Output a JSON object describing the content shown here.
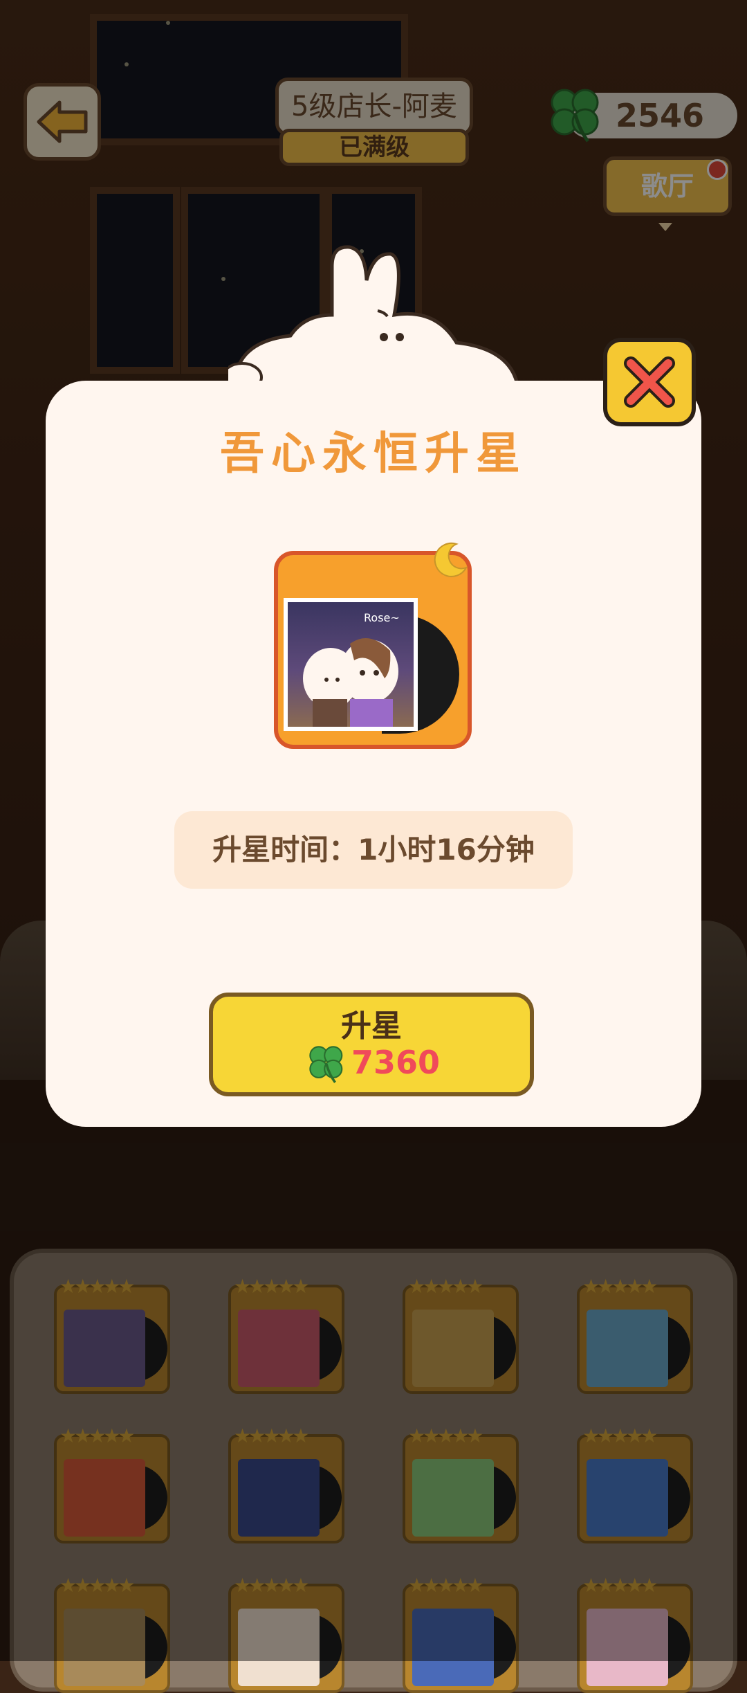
{
  "hud": {
    "level_title": "5级店长-阿麦",
    "level_status": "已满级",
    "clover_count": "2546",
    "hall_button": "歌厅"
  },
  "modal": {
    "title": "吾心永恒升星",
    "upgrade_time": "升星时间：1小时16分钟",
    "upgrade_button_label": "升星",
    "upgrade_cost": "7360",
    "album_caption": "Rose~"
  },
  "colors": {
    "accent_orange": "#f0983a",
    "button_yellow": "#f7d636",
    "cost_red": "#f04a5a",
    "close_yellow": "#f5c832"
  },
  "grid": {
    "cards": [
      {
        "stars": "★★★★★"
      },
      {
        "stars": "★★★★★"
      },
      {
        "stars": "★★★★★"
      },
      {
        "stars": "★★★★★"
      },
      {
        "stars": "★★★★★"
      },
      {
        "stars": "★★★★★"
      },
      {
        "stars": "★★★★★"
      },
      {
        "stars": "★★★★★"
      },
      {
        "stars": "★★★★★"
      },
      {
        "stars": "★★★★★"
      },
      {
        "stars": "★★★★★"
      },
      {
        "stars": "★★★★★"
      }
    ]
  }
}
